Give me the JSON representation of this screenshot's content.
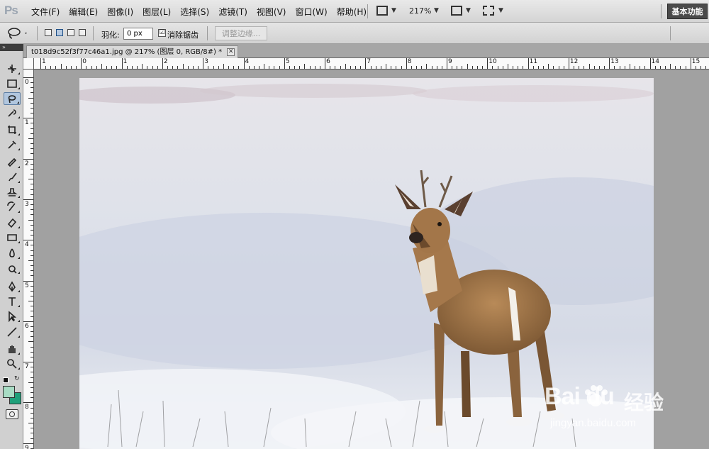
{
  "app": {
    "logo": "Ps"
  },
  "menu": [
    {
      "label": "文件(F)"
    },
    {
      "label": "编辑(E)"
    },
    {
      "label": "图像(I)"
    },
    {
      "label": "图层(L)"
    },
    {
      "label": "选择(S)"
    },
    {
      "label": "滤镜(T)"
    },
    {
      "label": "视图(V)"
    },
    {
      "label": "窗口(W)"
    },
    {
      "label": "帮助(H)"
    }
  ],
  "menubar": {
    "zoom": "217%",
    "workspace": "基本功能",
    "icons": [
      "bridge-icon",
      "arrange-icon",
      "screen-mode-icon"
    ]
  },
  "options": {
    "feather_label": "羽化:",
    "feather_value": "0 px",
    "antialias_label": "消除锯齿",
    "antialias_checked": "☑",
    "refine_edge": "调整边缘..."
  },
  "document": {
    "tab_title": "t018d9c52f3f77c46a1.jpg @ 217% (图层 0, RGB/8#) *",
    "close_glyph": "✕"
  },
  "ruler": {
    "h_labels": [
      "1",
      "0",
      "1",
      "2",
      "3",
      "4",
      "5",
      "6",
      "7",
      "8",
      "9",
      "10",
      "11",
      "12",
      "13",
      "14",
      "15"
    ],
    "v_labels": [
      "0",
      "1",
      "2",
      "3",
      "4",
      "5",
      "6",
      "7",
      "8",
      "9"
    ]
  },
  "tools": [
    "move-tool-icon",
    "marquee-tool-icon",
    "lasso-tool-icon",
    "quick-select-tool-icon",
    "crop-tool-icon",
    "eyedropper-tool-icon",
    "healing-brush-tool-icon",
    "brush-tool-icon",
    "clone-stamp-tool-icon",
    "history-brush-tool-icon",
    "eraser-tool-icon",
    "gradient-tool-icon",
    "blur-tool-icon",
    "dodge-tool-icon",
    "pen-tool-icon",
    "type-tool-icon",
    "path-select-tool-icon",
    "line-tool-icon",
    "hand-tool-icon",
    "zoom-tool-icon"
  ],
  "colors": {
    "foreground": "#a8dcc4",
    "background": "#1fa07a",
    "accent": "#b1c6de"
  },
  "watermark": {
    "brand": "Bai  du",
    "cn": "经验",
    "url": "jingyan.baidu.com"
  }
}
